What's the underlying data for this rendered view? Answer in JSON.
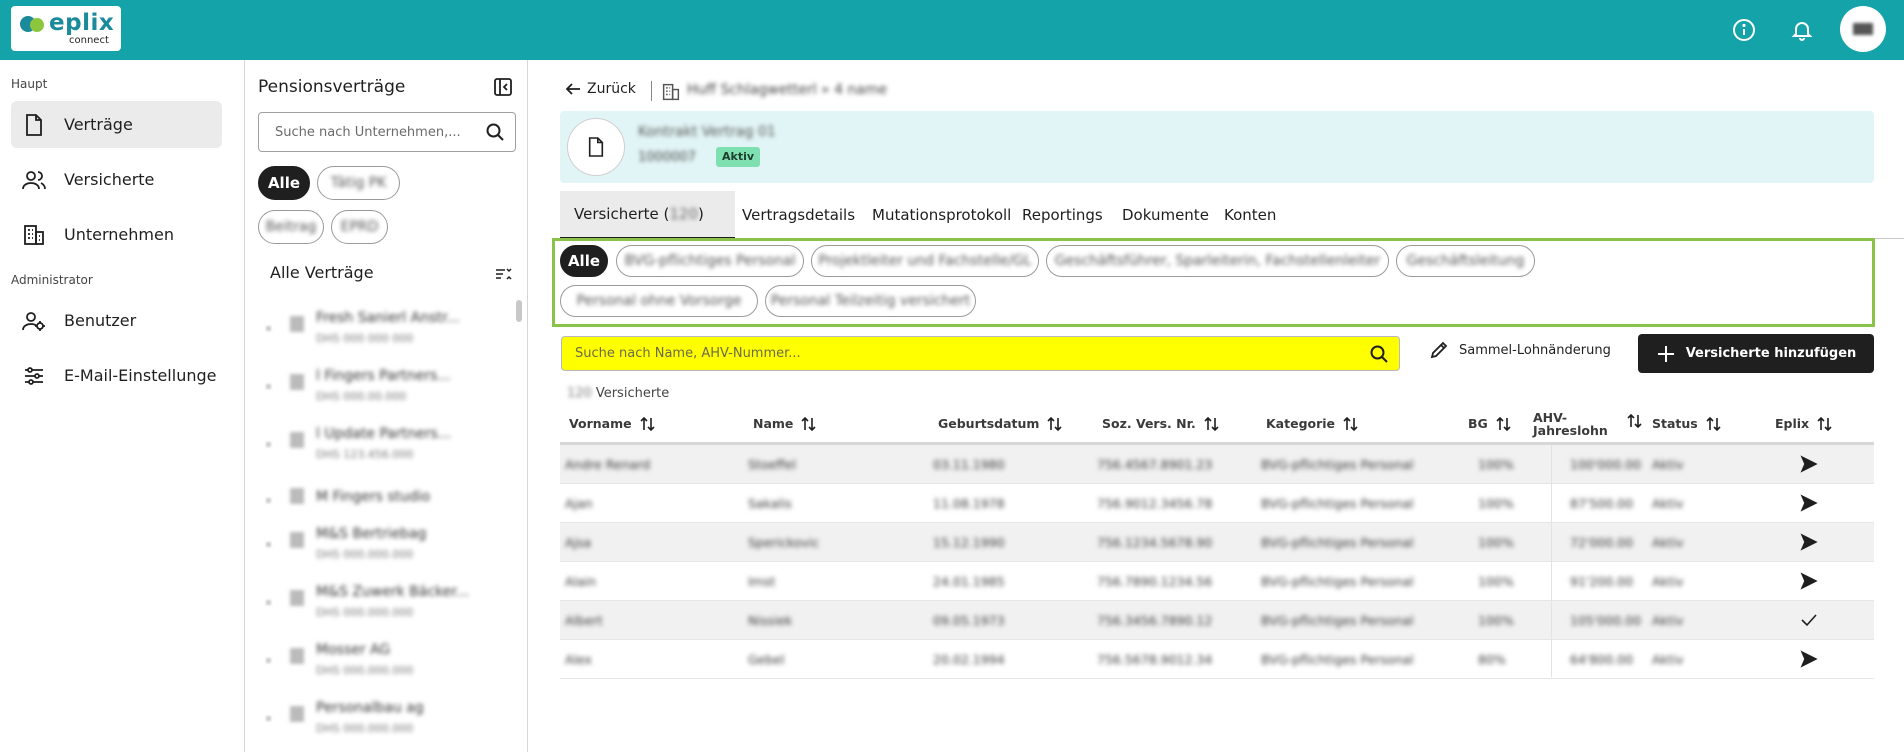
{
  "header": {
    "logo_text": "eplix",
    "logo_sub": "connect",
    "icons": [
      "info-icon",
      "bell-icon",
      "avatar"
    ]
  },
  "nav": {
    "section_main": "Haupt",
    "section_admin": "Administrator",
    "items": [
      {
        "label": "Verträge",
        "icon": "document-icon",
        "active": true
      },
      {
        "label": "Versicherte",
        "icon": "users-icon"
      },
      {
        "label": "Unternehmen",
        "icon": "building-icon"
      },
      {
        "label": "Benutzer",
        "icon": "user-admin-icon"
      },
      {
        "label": "E-Mail-Einstellunge",
        "icon": "sliders-icon"
      }
    ]
  },
  "contracts_panel": {
    "title": "Pensionsverträge",
    "search_placeholder": "Suche nach Unternehmen,...",
    "chips": [
      "Alle",
      "Tätig PK",
      "Beitrag",
      "EPRD"
    ],
    "list_title": "Alle Verträge",
    "items": [
      {
        "name": "Fresh Sanierl Anstr...",
        "no": "DHS 000 000 000"
      },
      {
        "name": "l Fingers Partners...",
        "no": "DHS 000.00.000"
      },
      {
        "name": "l Update Partners...",
        "no": "DHS 123.456.000"
      },
      {
        "name": "M Fingers studio",
        "no": ""
      },
      {
        "name": "M&S Bertriebag",
        "no": "DHS 000.000.000"
      },
      {
        "name": "M&S Zuwerk Bäcker...",
        "no": "DHS 000.000.000"
      },
      {
        "name": "Mosser AG",
        "no": "DHS 000.000.000"
      },
      {
        "name": "Personalbau ag",
        "no": "DHS 000.000.000"
      }
    ]
  },
  "main": {
    "back_label": "Zurück",
    "breadcrumb": "Huff Schlagwetterl » 4 name",
    "card": {
      "name": "Kontrakt Vertrag 01",
      "number": "1000007",
      "status": "Aktiv"
    },
    "tabs": [
      {
        "label": "Versicherte (",
        "count": "120",
        "close": ")",
        "active": true
      },
      {
        "label": "Vertragsdetails"
      },
      {
        "label": "Mutationsprotokoll"
      },
      {
        "label": "Reportings"
      },
      {
        "label": "Dokumente"
      },
      {
        "label": "Konten"
      }
    ],
    "filters": [
      "Alle",
      "BVG-pflichtiges Personal",
      "Projektleiter und Fachstelle/GL",
      "Geschäftsführer, Sparleiterin, Fachstellenleiter",
      "Geschäftsleitung",
      "Personal ohne Vorsorge",
      "Personal Teilzeitig versichert"
    ],
    "search_placeholder": "Suche nach Name, AHV-Nummer...",
    "sammel_label": "Sammel-Lohnänderung",
    "add_label": "Versicherte hinzufügen",
    "count": "120",
    "count_label": "Versicherte",
    "columns": [
      "Vorname",
      "Name",
      "Geburtsdatum",
      "Soz. Vers. Nr.",
      "Kategorie",
      "BG",
      "AHV-",
      "Jahreslohn",
      "Status",
      "Eplix"
    ],
    "rows": [
      {
        "vorname": "Andre Renard",
        "name": "Stoeffel",
        "geb": "03.11.1980",
        "soz": "756.4567.8901.23",
        "kat": "BVG-pflichtiges Personal",
        "bg": "100%",
        "lohn": "100'000.00",
        "status": "Aktiv",
        "eplix": "send-icon"
      },
      {
        "vorname": "Ajan",
        "name": "Sakalis",
        "geb": "11.08.1978",
        "soz": "756.9012.3456.78",
        "kat": "BVG-pflichtiges Personal",
        "bg": "100%",
        "lohn": "87'500.00",
        "status": "Aktiv",
        "eplix": "send-icon"
      },
      {
        "vorname": "Ajsa",
        "name": "Sperickovic",
        "geb": "15.12.1990",
        "soz": "756.1234.5678.90",
        "kat": "BVG-pflichtiges Personal",
        "bg": "100%",
        "lohn": "72'000.00",
        "status": "Aktiv",
        "eplix": "send-icon"
      },
      {
        "vorname": "Alain",
        "name": "Imst",
        "geb": "24.01.1985",
        "soz": "756.7890.1234.56",
        "kat": "BVG-pflichtiges Personal",
        "bg": "100%",
        "lohn": "91'200.00",
        "status": "Aktiv",
        "eplix": "send-icon"
      },
      {
        "vorname": "Albert",
        "name": "Nissiek",
        "geb": "09.05.1973",
        "soz": "756.3456.7890.12",
        "kat": "BVG-pflichtiges Personal",
        "bg": "100%",
        "lohn": "105'000.00",
        "status": "Aktiv",
        "eplix": "check-icon"
      },
      {
        "vorname": "Alex",
        "name": "Gebel",
        "geb": "20.02.1994",
        "soz": "756.5678.9012.34",
        "kat": "BVG-pflichtiges Personal",
        "bg": "80%",
        "lohn": "64'800.00",
        "status": "Aktiv",
        "eplix": "send-icon"
      }
    ]
  },
  "colors": {
    "brand": "#13a3a8",
    "accent_box": "#8bc34a",
    "highlight": "#ffff00",
    "badge": "#7ee0b0"
  }
}
